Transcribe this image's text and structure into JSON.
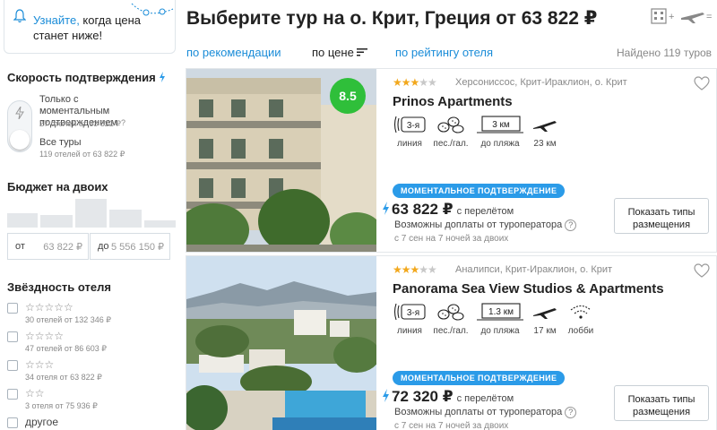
{
  "notify": {
    "link": "Узнайте,",
    "text": " когда цена станет ниже!"
  },
  "sidebar": {
    "confirm_title": "Скорость подтверждения",
    "opt_instant_label": "Только с моментальным подтверждением",
    "opt_instant_help": "?",
    "opt_instant_sub": "27 отелей от 63 822 ₽",
    "opt_all_label": "Все туры",
    "opt_all_sub": "119 отелей от 63 822 ₽",
    "budget_title": "Бюджет на двоих",
    "budget_from_label": "от",
    "budget_from_value": "63 822 ₽",
    "budget_to_label": "до",
    "budget_to_value": "5 556 150 ₽",
    "stars_title": "Звёздность отеля",
    "star_rows": [
      {
        "stars": "☆☆☆☆☆",
        "sub": "30 отелей от 132 346 ₽"
      },
      {
        "stars": "☆☆☆☆",
        "sub": "47 отелей от 86 603 ₽"
      },
      {
        "stars": "☆☆☆",
        "sub": "34 отеля от 63 822 ₽"
      },
      {
        "stars": "☆☆",
        "sub": "3 отеля от 75 936 ₽"
      }
    ],
    "other_label": "другое"
  },
  "header": {
    "title": "Выберите тур на о. Крит, Греция от 63 822 ₽",
    "sort_recommend": "по рекомендации",
    "sort_price": "по цене",
    "sort_rating": "по рейтингу отеля",
    "found": "Найдено 119 туров"
  },
  "cards": [
    {
      "rating": "8.5",
      "stars_on": "★★★",
      "stars_off": "★★",
      "location": "Херсониссос, Крит-Ираклион, о. Крит",
      "name": "Prinos Apartments",
      "line_badge": "3-я",
      "line_label": "линия",
      "beach_type": "пес./гал.",
      "beach_dist": "3 км",
      "beach_label": "до пляжа",
      "airport": "23 км",
      "instant": "МОМЕНТАЛЬНОЕ ПОДТВЕРЖДЕНИЕ",
      "price": "63 822 ₽",
      "price_note": "с перелётом",
      "extra": "Возможны доплаты от туроператора",
      "extra_help": "?",
      "dates": "с 7 сен на 7 ночей за двоих",
      "button": "Показать типы размещения"
    },
    {
      "stars_on": "★★★",
      "stars_off": "★★",
      "location": "Аналипси, Крит-Ираклион, о. Крит",
      "name": "Panorama Sea View Studios & Apartments",
      "line_badge": "3-я",
      "line_label": "линия",
      "beach_type": "пес./гал.",
      "beach_dist": "1.3 км",
      "beach_label": "до пляжа",
      "airport": "17 км",
      "lobby": "лобби",
      "instant": "МОМЕНТАЛЬНОЕ ПОДТВЕРЖДЕНИЕ",
      "price": "72 320 ₽",
      "price_note": "с перелётом",
      "extra": "Возможны доплаты от туроператора",
      "extra_help": "?",
      "dates": "с 7 сен на 7 ночей за двоих",
      "button": "Показать типы размещения"
    }
  ],
  "colors": {
    "accent": "#1a8cd8",
    "instant_badge": "#2b9be8",
    "rating_badge": "#2fbf3a",
    "star": "#f2a81d"
  }
}
